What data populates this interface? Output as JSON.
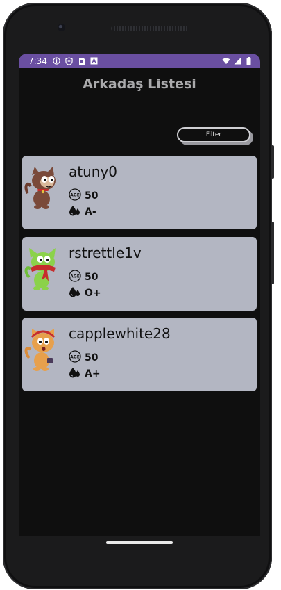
{
  "status_bar": {
    "time": "7:34",
    "left_icons": [
      "info-icon",
      "shield-icon",
      "sim-card-icon",
      "text-a-icon"
    ],
    "right_icons": [
      "wifi-icon",
      "signal-icon",
      "battery-icon"
    ],
    "color": "#6a4fa1"
  },
  "header": {
    "title": "Arkadaş Listesi"
  },
  "filter_button": {
    "label": "Filter"
  },
  "friends": [
    {
      "username": "atuny0",
      "age": "50",
      "blood_type": "A-",
      "avatar_color": "#7a4a3a"
    },
    {
      "username": "rstrettle1v",
      "age": "50",
      "blood_type": "O+",
      "avatar_color": "#8bd24a"
    },
    {
      "username": "capplewhite28",
      "age": "50",
      "blood_type": "A+",
      "avatar_color": "#e7a04c"
    }
  ],
  "icons": {
    "age": "age-badge-icon",
    "blood": "blood-drop-icon"
  }
}
